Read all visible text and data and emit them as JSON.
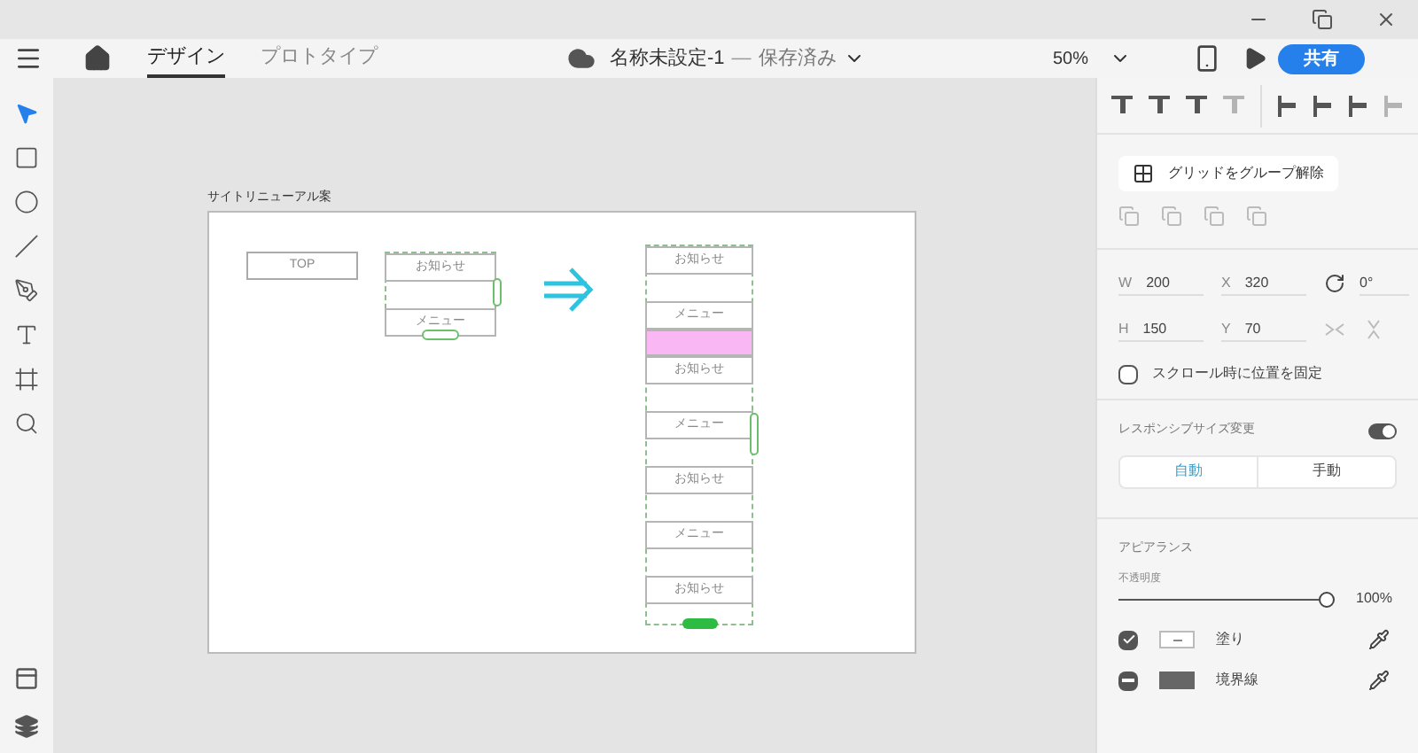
{
  "toolbar": {
    "tabs": [
      {
        "label": "デザイン",
        "selected": true
      },
      {
        "label": "プロトタイプ",
        "selected": false
      }
    ],
    "document": {
      "name": "名称未設定-1",
      "separator": "—",
      "status": "保存済み"
    },
    "zoom": "50%",
    "share": "共有"
  },
  "tools": [
    {
      "kind": "select",
      "selected": true
    },
    {
      "kind": "rectangle",
      "selected": false
    },
    {
      "kind": "ellipse",
      "selected": false
    },
    {
      "kind": "line",
      "selected": false
    },
    {
      "kind": "pen",
      "selected": false
    },
    {
      "kind": "text",
      "selected": false
    },
    {
      "kind": "artboard",
      "selected": false
    },
    {
      "kind": "zoom",
      "selected": false
    }
  ],
  "canvas": {
    "artboard": {
      "title": "サイトリニューアル案"
    },
    "top_box": "TOP",
    "small_list": [
      {
        "kind": "text",
        "label": "お知らせ"
      },
      {
        "kind": "blank"
      },
      {
        "kind": "text",
        "label": "メニュー"
      }
    ],
    "tall_list": [
      {
        "kind": "text",
        "label": "お知らせ"
      },
      {
        "kind": "blank"
      },
      {
        "kind": "text",
        "label": "メニュー"
      },
      {
        "kind": "highlight"
      },
      {
        "kind": "text",
        "label": "お知らせ"
      },
      {
        "kind": "blank"
      },
      {
        "kind": "text",
        "label": "メニュー"
      },
      {
        "kind": "blank"
      },
      {
        "kind": "text",
        "label": "お知らせ"
      },
      {
        "kind": "blank"
      },
      {
        "kind": "text",
        "label": "メニュー"
      },
      {
        "kind": "blank"
      },
      {
        "kind": "text",
        "label": "お知らせ"
      }
    ]
  },
  "panel": {
    "ungroup_button": "グリッドをグループ解除",
    "fields": [
      {
        "label": "W",
        "value": "200"
      },
      {
        "label": "X",
        "value": "320"
      },
      {
        "label": "H",
        "value": "150"
      },
      {
        "label": "Y",
        "value": "70"
      }
    ],
    "rotation": "0°",
    "fix_position": {
      "label": "スクロール時に位置を固定",
      "checked": false
    },
    "responsive": {
      "label": "レスポンシブサイズ変更",
      "on": true
    },
    "resize_modes": [
      {
        "label": "自動",
        "selected": true
      },
      {
        "label": "手動",
        "selected": false
      }
    ],
    "appearance": {
      "title": "アピアランス",
      "opacity_label": "不透明度",
      "level": 1,
      "reading": "100%"
    },
    "styles": [
      {
        "label": "塗り",
        "checked": true,
        "indeterminate": false,
        "kind": "fill"
      },
      {
        "label": "境界線",
        "checked": true,
        "indeterminate": true,
        "kind": "border"
      }
    ]
  }
}
